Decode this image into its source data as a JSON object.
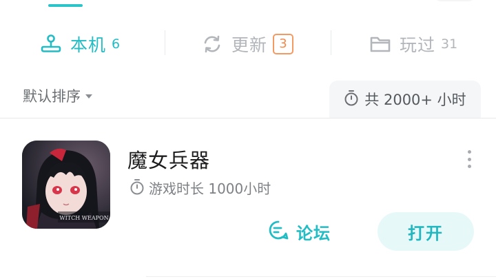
{
  "tabs": {
    "local": {
      "label": "本机",
      "count": "6",
      "icon": "joystick-icon"
    },
    "update": {
      "label": "更新",
      "badge": "3",
      "icon": "refresh-icon"
    },
    "played": {
      "label": "玩过",
      "count": "31",
      "icon": "folder-icon"
    }
  },
  "sort": {
    "label": "默认排序"
  },
  "total": {
    "text": "共 2000+ 小时",
    "icon": "stopwatch-icon"
  },
  "game": {
    "title": "魔女兵器",
    "icon_caption": "WITCH WEAPON",
    "playtime": "游戏时长 1000小时",
    "forum_label": "论坛",
    "open_label": "打开"
  },
  "colors": {
    "accent": "#22bcc4",
    "badge": "#f28a4c",
    "inactive": "#b2b6ba"
  }
}
